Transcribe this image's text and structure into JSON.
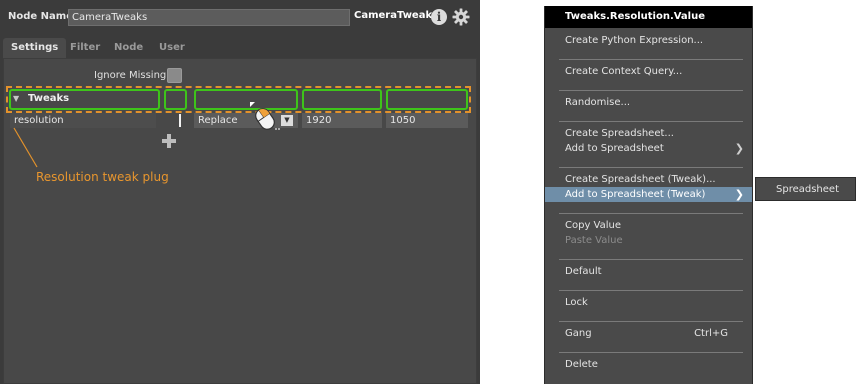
{
  "editor": {
    "node_name_label": "Node Name",
    "node_name_value": "CameraTweaks",
    "node_type": "CameraTweaks",
    "tabs": [
      "Settings",
      "Filter",
      "Node",
      "User"
    ],
    "active_tab": "Settings",
    "ignore_missing_label": "Ignore Missing",
    "tweaks_label": "Tweaks",
    "tweak_row": {
      "name": "resolution",
      "mode": "Replace",
      "value_x": "1920",
      "value_y": "1050"
    },
    "callout": "Resolution tweak plug"
  },
  "menu": {
    "title": "Tweaks.Resolution.Value",
    "items": [
      {
        "label": "Create Python Expression..."
      },
      {
        "label": "Create Context Query..."
      },
      {
        "label": "Randomise..."
      },
      {
        "label": "Create Spreadsheet..."
      },
      {
        "label": "Add to Spreadsheet"
      },
      {
        "label": "Create Spreadsheet (Tweak)..."
      },
      {
        "label": "Add to Spreadsheet (Tweak)"
      },
      {
        "label": "Copy Value"
      },
      {
        "label": "Paste Value"
      },
      {
        "label": "Default"
      },
      {
        "label": "Lock"
      },
      {
        "label": "Gang",
        "shortcut": "Ctrl+G"
      },
      {
        "label": "Delete"
      }
    ],
    "submenu": {
      "label": "Spreadsheet"
    }
  },
  "colors": {
    "highlight_green": "#3ec41a",
    "outline_orange": "#e3922b",
    "menu_highlight": "#6f8ea8"
  }
}
